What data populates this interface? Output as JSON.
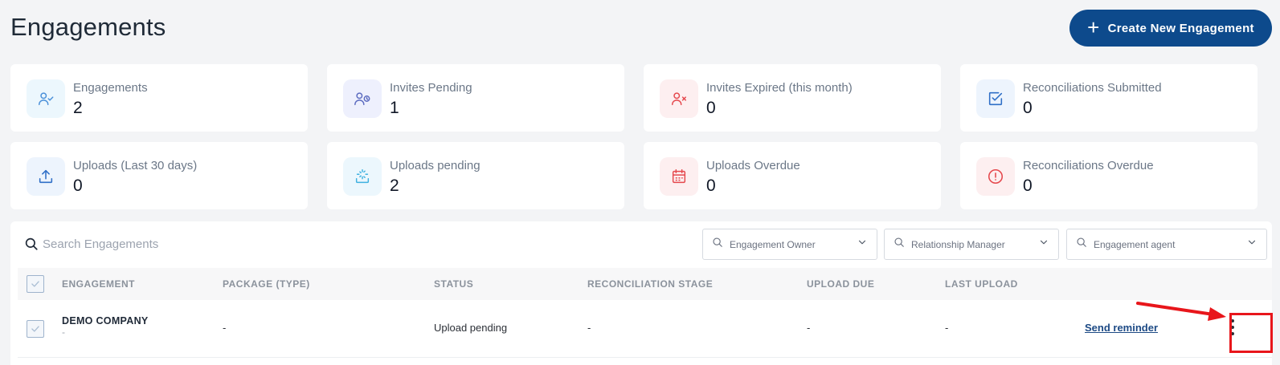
{
  "page": {
    "title": "Engagements"
  },
  "actions": {
    "create_label": "Create New Engagement"
  },
  "stats": [
    {
      "label": "Engagements",
      "value": "2",
      "icon": "user-check-icon",
      "color": "#4a90d9"
    },
    {
      "label": "Invites Pending",
      "value": "1",
      "icon": "user-clock-icon",
      "color": "#5c6bc0"
    },
    {
      "label": "Invites Expired (this month)",
      "value": "0",
      "icon": "user-x-icon",
      "color": "#e5484d"
    },
    {
      "label": "Reconciliations Submitted",
      "value": "0",
      "icon": "checkbox-icon",
      "color": "#2f6fc7"
    },
    {
      "label": "Uploads (Last 30 days)",
      "value": "0",
      "icon": "upload-icon",
      "color": "#2f6fc7"
    },
    {
      "label": "Uploads pending",
      "value": "2",
      "icon": "upload-loading-icon",
      "color": "#3fb1e0"
    },
    {
      "label": "Uploads Overdue",
      "value": "0",
      "icon": "calendar-icon",
      "color": "#e5484d"
    },
    {
      "label": "Reconciliations Overdue",
      "value": "0",
      "icon": "alert-circle-icon",
      "color": "#e5484d"
    }
  ],
  "search": {
    "placeholder": "Search Engagements"
  },
  "filters": [
    {
      "placeholder": "Engagement Owner"
    },
    {
      "placeholder": "Relationship Manager"
    },
    {
      "placeholder": "Engagement agent"
    }
  ],
  "table": {
    "columns": [
      "ENGAGEMENT",
      "PACKAGE (TYPE)",
      "STATUS",
      "RECONCILIATION STAGE",
      "UPLOAD DUE",
      "LAST UPLOAD"
    ],
    "rows": [
      {
        "engagement": "DEMO COMPANY",
        "engagement_sub": "-",
        "package": "-",
        "status": "Upload pending",
        "reconciliation_stage": "-",
        "upload_due": "-",
        "last_upload": "-",
        "action_label": "Send reminder"
      }
    ]
  },
  "colors": {
    "accent": "#0d4a8c",
    "annotation": "#e8161b"
  }
}
